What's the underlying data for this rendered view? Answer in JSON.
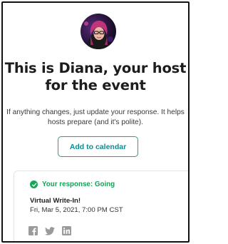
{
  "host": {
    "avatar_icon": "host-avatar-photo",
    "heading": "This is Diana, your host for the event",
    "subtext": "If anything changes, just update your response. It helps hosts prepare (and it's polite)."
  },
  "actions": {
    "add_to_calendar_label": "Add to calendar"
  },
  "response_card": {
    "status_label": "Your response: Going",
    "event_title": "Virtual Write-In!",
    "event_datetime": "Fri, Mar 5, 2021, 7:00 PM CST",
    "share_icons": [
      "facebook-icon",
      "twitter-icon",
      "linkedin-icon"
    ]
  },
  "colors": {
    "accent_teal": "#1ba0a5",
    "going_green": "#16a65a",
    "social_gray": "#9a9a9a"
  }
}
